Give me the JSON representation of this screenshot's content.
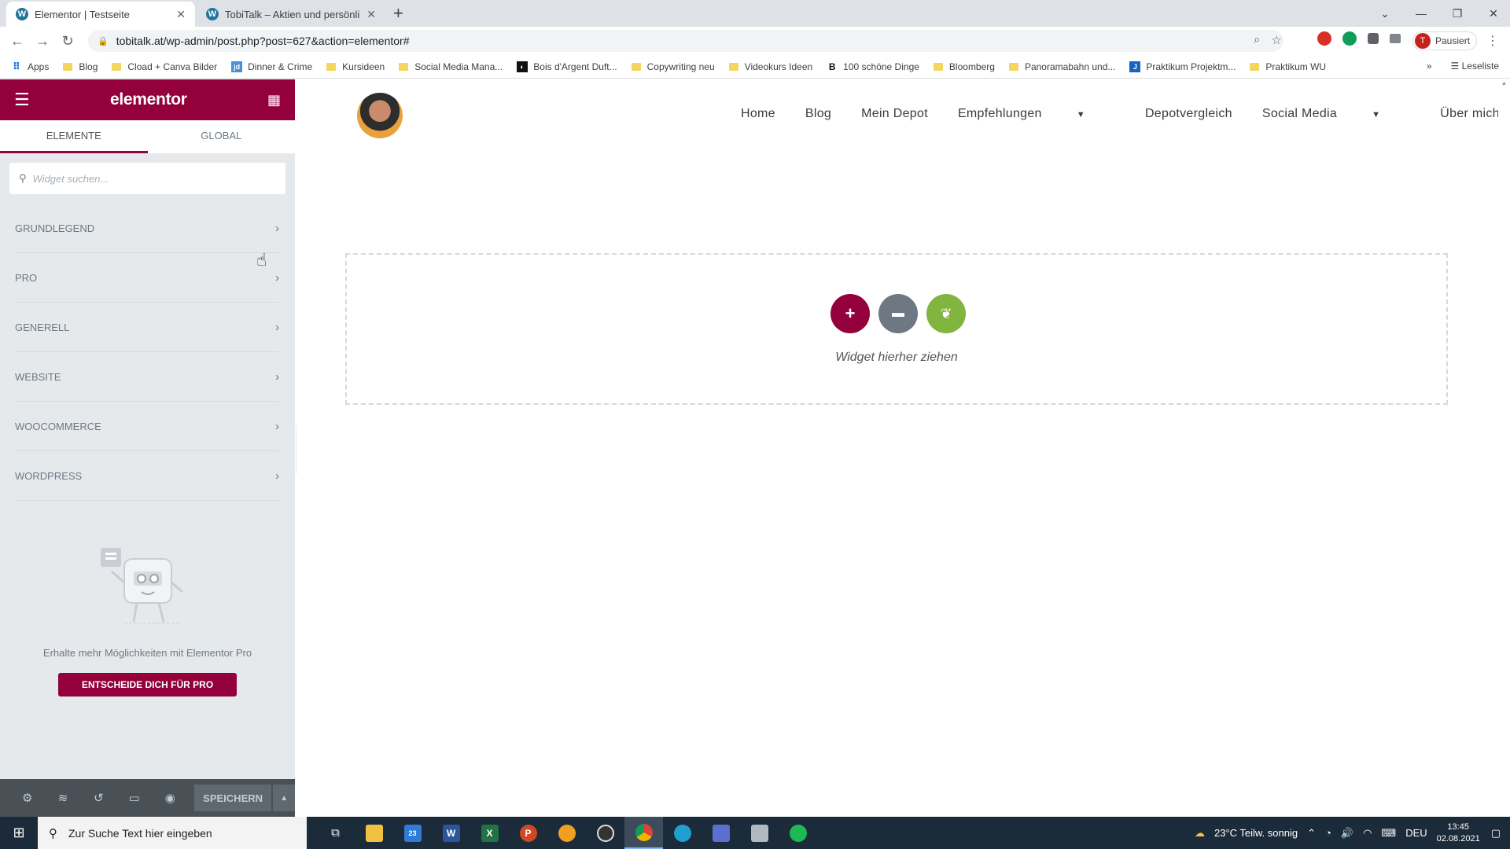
{
  "browser": {
    "tabs": [
      {
        "title": "Elementor | Testseite",
        "active": true
      },
      {
        "title": "TobiTalk – Aktien und persönliche",
        "active": false
      }
    ],
    "url": "tobitalk.at/wp-admin/post.php?post=627&action=elementor#",
    "profile_initial": "T",
    "profile_label": "Pausiert",
    "bookmarks": [
      "Apps",
      "Blog",
      "Cload + Canva Bilder",
      "Dinner & Crime",
      "Kursideen",
      "Social Media Mana...",
      "Bois d'Argent Duft...",
      "Copywriting neu",
      "Videokurs Ideen",
      "100 schöne Dinge",
      "Bloomberg",
      "Panoramabahn und...",
      "Praktikum Projektm...",
      "Praktikum WU"
    ],
    "reading_list": "Leseliste"
  },
  "panel": {
    "logo": "elementor",
    "tabs": [
      "ELEMENTE",
      "GLOBAL"
    ],
    "search_placeholder": "Widget suchen...",
    "categories": [
      "GRUNDLEGEND",
      "PRO",
      "GENERELL",
      "WEBSITE",
      "WOOCOMMERCE",
      "WORDPRESS"
    ],
    "promo_text": "Erhalte mehr Möglichkeiten mit Elementor Pro",
    "promo_button": "ENTSCHEIDE DICH FÜR PRO",
    "save_label": "SPEICHERN",
    "accent": "#93003c"
  },
  "site": {
    "menu": [
      {
        "label": "Home",
        "dropdown": false
      },
      {
        "label": "Blog",
        "dropdown": false
      },
      {
        "label": "Mein Depot",
        "dropdown": false
      },
      {
        "label": "Empfehlungen",
        "dropdown": true
      },
      {
        "label": "Depotvergleich",
        "dropdown": false
      },
      {
        "label": "Social Media",
        "dropdown": true
      },
      {
        "label": "Über mich",
        "dropdown": true
      }
    ],
    "dropzone_text": "Widget hierher ziehen",
    "button_colors": {
      "add": "#93003c",
      "template": "#6d7882",
      "envato": "#82b440"
    }
  },
  "taskbar": {
    "search_placeholder": "Zur Suche Text hier eingeben",
    "mail_badge": "23",
    "weather": "23°C  Teilw. sonnig",
    "language": "DEU",
    "time": "13:45",
    "date": "02.08.2021"
  }
}
